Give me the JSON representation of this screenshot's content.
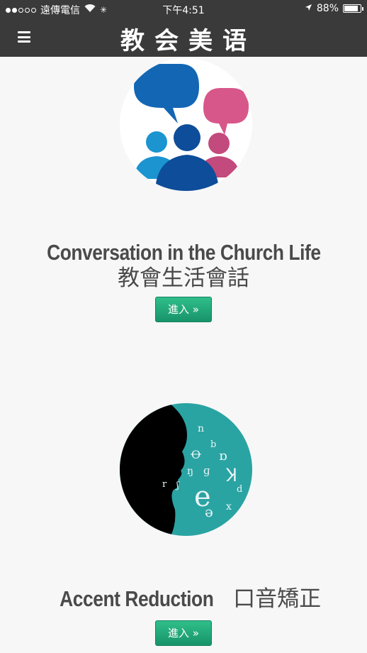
{
  "status_bar": {
    "carrier": "遠傳電信",
    "time": "下午4:51",
    "battery_percent": "88%",
    "battery_level": 0.88,
    "signal_bars_filled": 2,
    "signal_bars_total": 5
  },
  "nav": {
    "brand": "教会美语"
  },
  "sections": [
    {
      "title_en": "Conversation in the Church Life",
      "title_zh": "教會生活會話",
      "button_label": "進入 »"
    },
    {
      "title_en": "Accent Reduction",
      "title_zh": "口音矯正",
      "button_label": "進入 »"
    }
  ],
  "colors": {
    "nav_bg": "#3a3a3a",
    "button_green": "#20a57a",
    "title_text": "#4a4a4a"
  }
}
